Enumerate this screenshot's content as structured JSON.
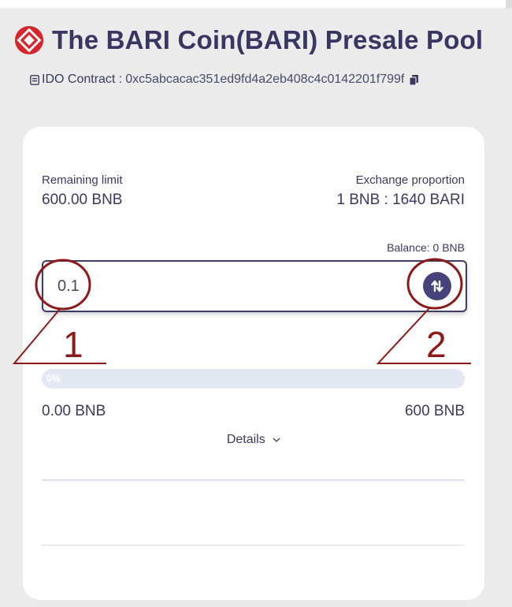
{
  "header": {
    "title": "The BARI Coin(BARI) Presale Pool",
    "contract_label": "IDO Contract :",
    "contract_address": "0xc5abcacac351ed9fd4a2eb408c4c0142201f799f"
  },
  "card": {
    "remaining_limit_label": "Remaining limit",
    "remaining_limit_value": "600.00 BNB",
    "exchange_label": "Exchange proportion",
    "exchange_value": "1 BNB : 1640 BARI",
    "balance_text": "Balance: 0 BNB",
    "amount_input_value": "0.1",
    "progress_text": "0%",
    "progress_fraction": 0,
    "raised_value": "0.00 BNB",
    "cap_value": "600 BNB",
    "details_label": "Details"
  },
  "annotations": {
    "label_1": "1",
    "label_2": "2",
    "color": "#8b1a1a"
  },
  "colors": {
    "brand": "#d6262d",
    "primary": "#46437a",
    "text": "#3b3a5c",
    "progress_track": "#e4e8f3"
  }
}
